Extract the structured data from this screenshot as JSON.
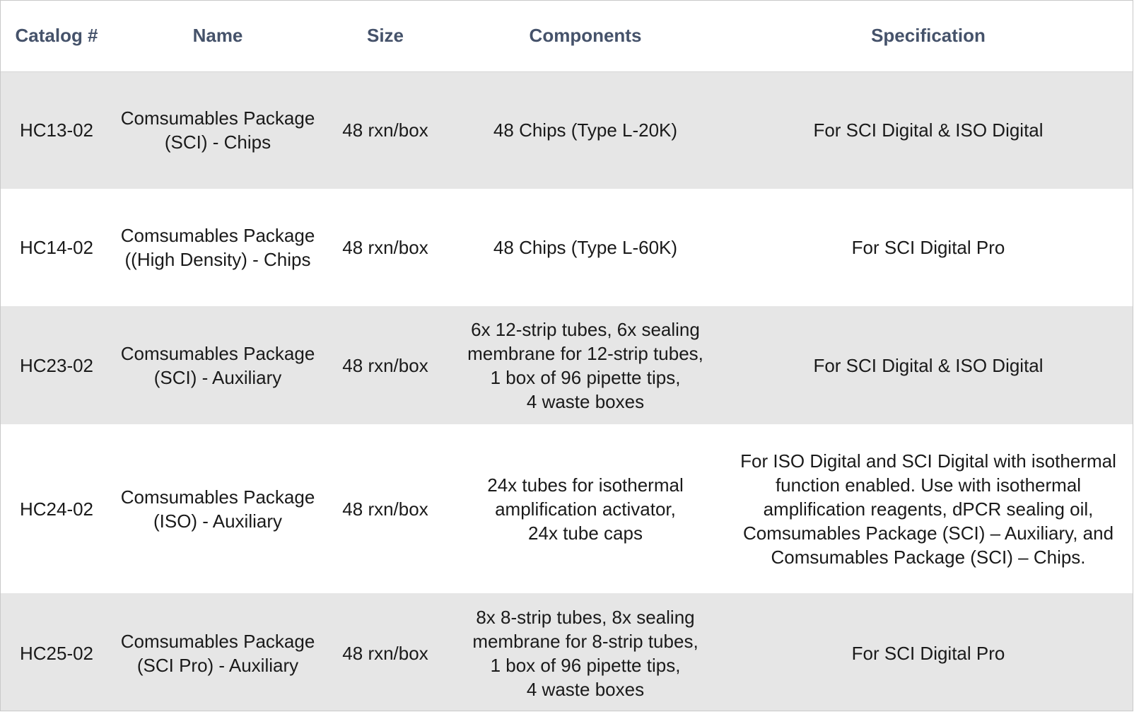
{
  "table": {
    "headers": {
      "catalog": "Catalog #",
      "name": "Name",
      "size": "Size",
      "components": "Components",
      "specification": "Specification"
    },
    "rows": [
      {
        "catalog": "HC13-02",
        "name": "Comsumables Package\n(SCI) - Chips",
        "size": "48 rxn/box",
        "components": "48 Chips (Type L-20K)",
        "specification": "For SCI Digital & ISO Digital"
      },
      {
        "catalog": "HC14-02",
        "name": "Comsumables Package\n((High Density) - Chips",
        "size": "48 rxn/box",
        "components": "48 Chips (Type L-60K)",
        "specification": "For SCI Digital Pro"
      },
      {
        "catalog": "HC23-02",
        "name": "Comsumables Package\n(SCI) - Auxiliary",
        "size": "48 rxn/box",
        "components": "6x 12-strip tubes, 6x sealing\nmembrane for 12-strip tubes,\n1 box of 96 pipette tips,\n4 waste boxes",
        "specification": "For SCI Digital & ISO Digital"
      },
      {
        "catalog": "HC24-02",
        "name": "Comsumables Package\n(ISO) - Auxiliary",
        "size": "48 rxn/box",
        "components": "24x tubes for isothermal\namplification activator,\n24x tube caps",
        "specification": "For ISO Digital and SCI Digital with isothermal\nfunction enabled. Use with isothermal\namplification reagents, dPCR sealing oil,\nComsumables Package (SCI) – Auxiliary, and\nComsumables Package (SCI) – Chips."
      },
      {
        "catalog": "HC25-02",
        "name": "Comsumables Package\n(SCI Pro) - Auxiliary",
        "size": "48 rxn/box",
        "components": "8x 8-strip tubes, 8x sealing\nmembrane for 8-strip tubes,\n1 box of 96 pipette tips,\n4 waste boxes",
        "specification": "For SCI Digital Pro"
      }
    ]
  },
  "colors": {
    "header_text": "#45526a",
    "shaded_row": "#e6e6e6",
    "plain_row": "#ffffff"
  }
}
